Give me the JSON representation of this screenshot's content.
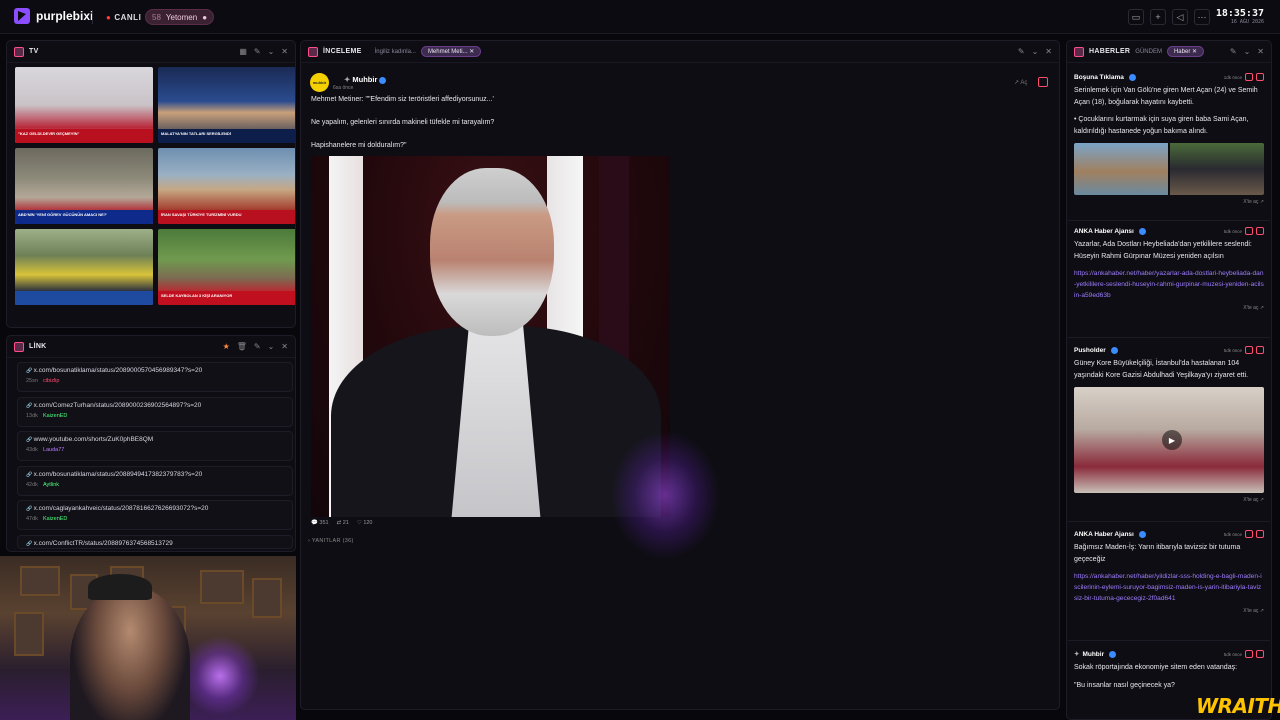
{
  "topbar": {
    "logo": "purplebixi",
    "live": "CANLI",
    "user_count": "58",
    "user_name": "Yetomen",
    "time": "18:35:37",
    "date": "16 AĞU 2026",
    "icons": [
      "window-icon",
      "plus-icon",
      "volume-icon",
      "more-icon"
    ]
  },
  "tv": {
    "title": "TV",
    "tiles": [
      {
        "ticker": "\"KAZ GELDİ-DEVİR GEÇMEYİN\""
      },
      {
        "ticker": "MALATYA'NIN TATLARI SERGİLENDİ"
      },
      {
        "ticker": "ABD'NİN 'YENİ GÖREV GÜCÜNÜN AMACI NE?'"
      },
      {
        "ticker": "İRAN SAVAŞI TÜRKİYE TURİZMİNİ VURDU"
      },
      {
        "ticker": ""
      },
      {
        "ticker": "SELDE KAYBOLAN 3 KİŞİ ARANIYOR"
      }
    ]
  },
  "link": {
    "title": "LİNK",
    "items": [
      {
        "url": "x.com/bosunatiklama/status/2089000570456989347?s=20",
        "ago": "25sn",
        "user": "cibizlip",
        "color": "#ff4d6d"
      },
      {
        "url": "x.com/ComezTurhan/status/2089000236902564897?s=20",
        "ago": "13dk",
        "user": "KaizenED",
        "color": "#4dff7a"
      },
      {
        "url": "www.youtube.com/shorts/ZuK0phBE8QM",
        "ago": "43dk",
        "user": "Lauda77",
        "color": "#b77dff"
      },
      {
        "url": "x.com/bosunatiklama/status/2088949417382379783?s=20",
        "ago": "42dk",
        "user": "Aytlink",
        "color": "#4dff7a"
      },
      {
        "url": "x.com/caglayankahveic/status/2087816627626693072?s=20",
        "ago": "47dk",
        "user": "KaizenED",
        "color": "#4dff7a"
      },
      {
        "url": "x.com/ConflictTR/status/2088976374568513729",
        "ago": "",
        "user": "",
        "color": "#4dff7a"
      }
    ]
  },
  "inceleme": {
    "title": "İNCELEME",
    "sub": "İngiliz kadınla...",
    "chip": "Mehmet Meti...",
    "author": "Muhbir",
    "avatar": "muhbir",
    "time": "6sa önce",
    "open": "Aç",
    "lines": [
      "Mehmet Metiner: \"\"Efendim siz teröristleri affediyorsunuz...'",
      "Ne yapalım, gelenleri sınırda makineli tüfekle mi tarayalım?",
      "Hapishanelere mi dolduralım?\""
    ],
    "stats": {
      "replies": "351",
      "retweets": "21",
      "likes": "120"
    },
    "replies_label": "YANITLAR (36)"
  },
  "haberler": {
    "title": "HABERLER",
    "sub": "GÜNDEM",
    "chip": "Haber",
    "cards": [
      {
        "author": "Boşuna Tıklama",
        "ago": "1dk önce",
        "text": "Serinlemek için Van Gölü'ne giren Mert Açan (24) ve Semih Açan (18), boğularak hayatını kaybetti.",
        "text2": "• Çocuklarını kurtarmak için suya giren baba Sami Açan, kaldırıldığı hastanede yoğun bakıma alındı.",
        "link": "",
        "open": "X'te aç"
      },
      {
        "author": "ANKA Haber Ajansı",
        "ago": "5dk önce",
        "text": "Yazarlar, Ada Dostları Heybeliada'dan yetkililere seslendi: Hüseyin Rahmi Gürpınar Müzesi yeniden açılsın",
        "text2": "",
        "link": "https://ankahaber.net/haber/yazarlar-ada-dostlari-heybeliada-dan-yetkililere-seslendi-huseyin-rahmi-gurpinar-muzesi-yeniden-acilsin-a59ed63b",
        "open": "X'te aç"
      },
      {
        "author": "Pusholder",
        "ago": "5dk önce",
        "text": "Güney Kore Büyükelçiliği, İstanbul'da hastalanan 104 yaşındaki Kore Gazisi Abdulhadi Yeşilkaya'yı ziyaret etti.",
        "text2": "",
        "link": "",
        "open": "X'te aç"
      },
      {
        "author": "ANKA Haber Ajansı",
        "ago": "5dk önce",
        "text": "Bağımsız Maden-İş: Yarın itibarıyla tavizsiz bir tutuma geçeceğiz",
        "text2": "",
        "link": "https://ankahaber.net/haber/yildizlar-sss-holding-e-bagli-maden-iscilerinin-eylemi-suruyor-bagimsiz-maden-is-yarin-itibariyla-tavizsiz-bir-tutuma-gececegiz-2f0ad641",
        "open": "X'te aç"
      },
      {
        "author": "Muhbir",
        "ago": "5dk önce",
        "text": "Sokak röportajında ekonomiye sitem eden vatandaş:",
        "text2": "\"Bu insanlar nasıl geçinecek ya?",
        "link": "",
        "open": ""
      }
    ]
  },
  "overlay": {
    "brand": "WRAITH"
  }
}
